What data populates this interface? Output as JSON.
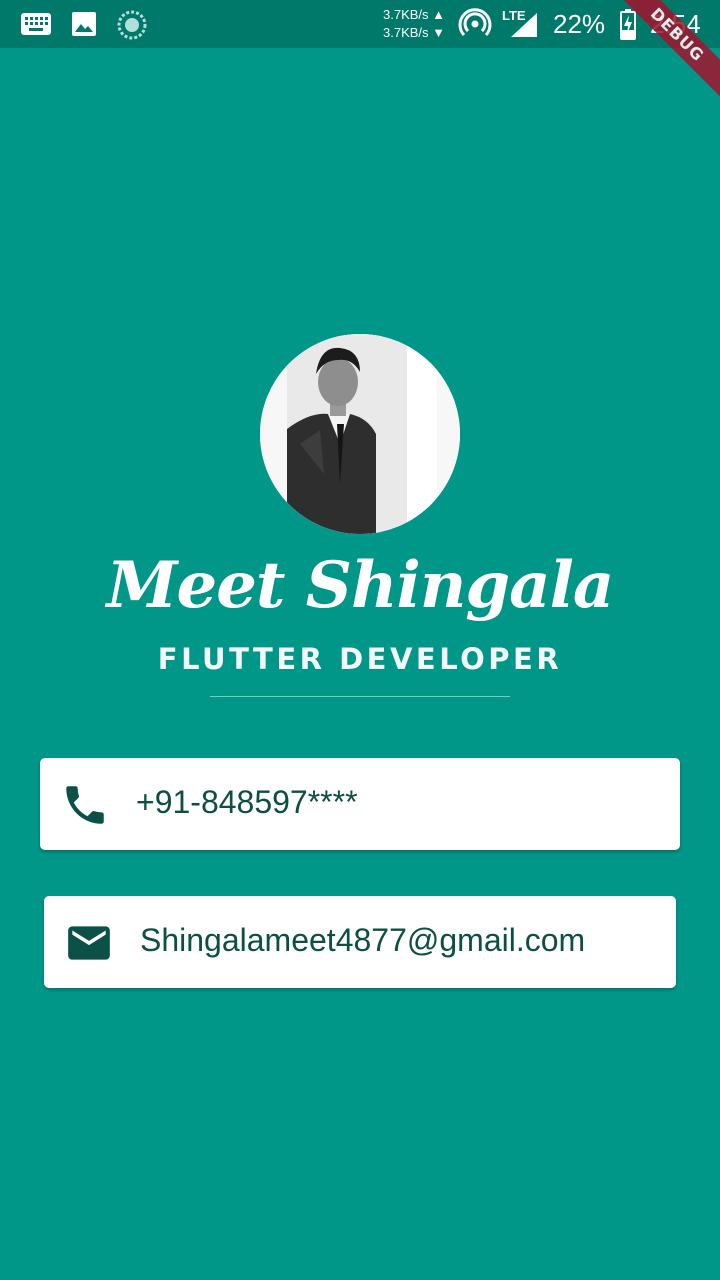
{
  "status_bar": {
    "net_up": "3.7KB/s",
    "net_down": "3.7KB/s",
    "network_type": "LTE",
    "battery_percent": "22%",
    "time": "2:54",
    "icons": [
      "keyboard-icon",
      "image-icon",
      "sync-icon",
      "hotspot-icon",
      "signal-icon",
      "battery-charging-icon"
    ]
  },
  "debug_banner": "DEBUG",
  "profile": {
    "name": "Meet Shingala",
    "title": "FLUTTER DEVELOPER"
  },
  "contacts": {
    "phone": {
      "icon": "phone-icon",
      "value": "+91-848597****"
    },
    "email": {
      "icon": "mail-icon",
      "value": "Shingalameet4877@gmail.com"
    }
  },
  "colors": {
    "background": "#009688",
    "status_bar": "#00796b",
    "card_text": "#0e4f43",
    "icon": "#0b5147"
  }
}
